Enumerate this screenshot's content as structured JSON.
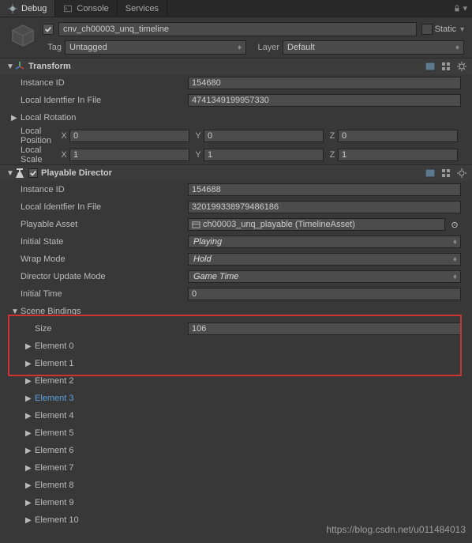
{
  "tabs": {
    "debug": "Debug",
    "console": "Console",
    "services": "Services"
  },
  "header": {
    "name": "cnv_ch00003_unq_timeline",
    "tag_label": "Tag",
    "tag_value": "Untagged",
    "layer_label": "Layer",
    "layer_value": "Default",
    "static_label": "Static"
  },
  "transform": {
    "title": "Transform",
    "instance_id_label": "Instance ID",
    "instance_id": "154680",
    "local_id_label": "Local Identfier In File",
    "local_id": "4741349199957330",
    "local_rotation_label": "Local Rotation",
    "local_position_label": "Local Position",
    "local_position": {
      "x": "0",
      "y": "0",
      "z": "0"
    },
    "local_scale_label": "Local Scale",
    "local_scale": {
      "x": "1",
      "y": "1",
      "z": "1"
    }
  },
  "director": {
    "title": "Playable Director",
    "instance_id_label": "Instance ID",
    "instance_id": "154688",
    "local_id_label": "Local Identfier In File",
    "local_id": "3201993389794861­86",
    "local_id_val": "320199338979486186",
    "playable_asset_label": "Playable Asset",
    "playable_asset": "ch00003_unq_playable (TimelineAsset)",
    "initial_state_label": "Initial State",
    "initial_state": "Playing",
    "wrap_mode_label": "Wrap Mode",
    "wrap_mode": "Hold",
    "director_update_mode_label": "Director Update Mode",
    "director_update_mode": "Game Time",
    "initial_time_label": "Initial Time",
    "initial_time": "0",
    "scene_bindings_label": "Scene Bindings",
    "size_label": "Size",
    "size": "106",
    "elements": [
      "Element 0",
      "Element 1",
      "Element 2",
      "Element 3",
      "Element 4",
      "Element 5",
      "Element 6",
      "Element 7",
      "Element 8",
      "Element 9",
      "Element 10"
    ],
    "highlight_index": 3
  },
  "xyz": {
    "x": "X",
    "y": "Y",
    "z": "Z"
  },
  "watermark": "https://blog.csdn.net/u011484013"
}
